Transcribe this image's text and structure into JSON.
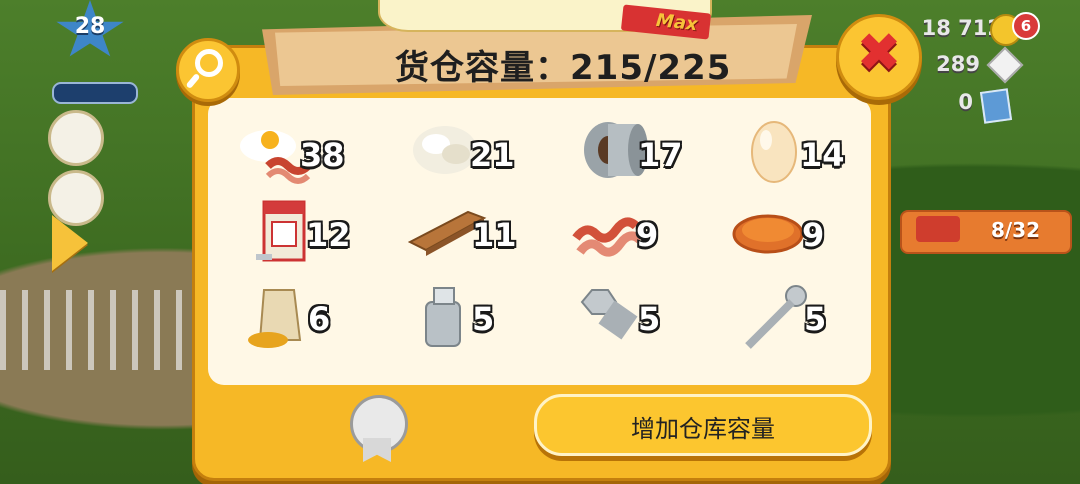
{
  "hud": {
    "level": "28",
    "coins": "18 712",
    "gems": "289",
    "cards": "0",
    "notification_count": "6",
    "truck_progress": "8/32"
  },
  "storage": {
    "title": "货仓容量：215/225",
    "max_tag": "Max",
    "upgrade_button": "增加仓库容量"
  },
  "items": [
    {
      "name": "bacon-and-eggs",
      "count": "38"
    },
    {
      "name": "wool",
      "count": "21"
    },
    {
      "name": "duct-tape",
      "count": "17"
    },
    {
      "name": "egg",
      "count": "14"
    },
    {
      "name": "sugar-box",
      "count": "12"
    },
    {
      "name": "plank",
      "count": "11"
    },
    {
      "name": "bacon",
      "count": "9"
    },
    {
      "name": "pie",
      "count": "9"
    },
    {
      "name": "chicken-feed",
      "count": "6"
    },
    {
      "name": "milk-can",
      "count": "5"
    },
    {
      "name": "bolt",
      "count": "5"
    },
    {
      "name": "screw",
      "count": "5"
    }
  ],
  "colors": {
    "panel": "#f6b826",
    "inner": "#fff8e6",
    "close": "#e23030",
    "button": "#fcc62f"
  }
}
